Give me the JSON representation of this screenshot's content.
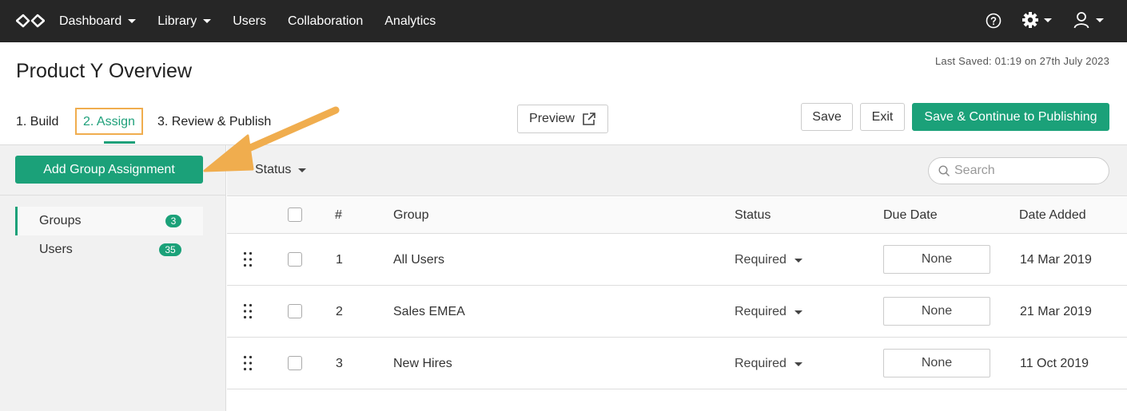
{
  "nav": {
    "items": [
      {
        "label": "Dashboard",
        "has_caret": true
      },
      {
        "label": "Library",
        "has_caret": true
      },
      {
        "label": "Users",
        "has_caret": false
      },
      {
        "label": "Collaboration",
        "has_caret": false
      },
      {
        "label": "Analytics",
        "has_caret": false
      }
    ],
    "icons": [
      "infinity-logo-icon",
      "help-icon",
      "gear-icon",
      "user-icon"
    ]
  },
  "header": {
    "title": "Product Y Overview",
    "last_saved": "Last Saved: 01:19 on 27th July 2023"
  },
  "steps": [
    {
      "label": "1. Build"
    },
    {
      "label": "2. Assign",
      "active": true
    },
    {
      "label": "3. Review & Publish"
    }
  ],
  "actions": {
    "preview": "Preview",
    "save": "Save",
    "exit": "Exit",
    "continue": "Save & Continue to Publishing"
  },
  "sidebar": {
    "add_button": "Add Group Assignment",
    "items": [
      {
        "label": "Groups",
        "count": "3",
        "active": true
      },
      {
        "label": "Users",
        "count": "35",
        "active": false
      }
    ]
  },
  "filters": {
    "status_label": "Status",
    "search_placeholder": "Search"
  },
  "table": {
    "columns": [
      "#",
      "Group",
      "Status",
      "Due Date",
      "Date Added"
    ],
    "rows": [
      {
        "num": "1",
        "group": "All Users",
        "status": "Required",
        "due": "None",
        "added": "14 Mar 2019"
      },
      {
        "num": "2",
        "group": "Sales EMEA",
        "status": "Required",
        "due": "None",
        "added": "21 Mar 2019"
      },
      {
        "num": "3",
        "group": "New Hires",
        "status": "Required",
        "due": "None",
        "added": "11 Oct 2019"
      }
    ]
  },
  "colors": {
    "nav_bg": "#262626",
    "accent": "#1ba179",
    "highlight": "#f0ad4e"
  }
}
